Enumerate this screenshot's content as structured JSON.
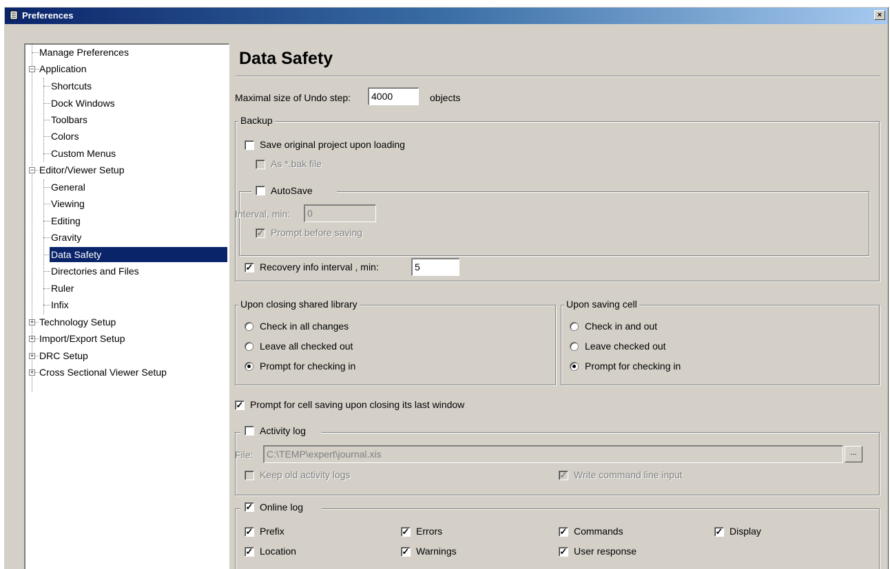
{
  "window": {
    "title": "Preferences",
    "close_glyph": "×"
  },
  "tree": {
    "items": [
      {
        "label": "Manage Preferences"
      },
      {
        "label": "Application",
        "expander": "−"
      },
      {
        "label": "Shortcuts"
      },
      {
        "label": "Dock Windows"
      },
      {
        "label": "Toolbars"
      },
      {
        "label": "Colors"
      },
      {
        "label": "Custom Menus"
      },
      {
        "label": "Editor/Viewer Setup",
        "expander": "−"
      },
      {
        "label": "General"
      },
      {
        "label": "Viewing"
      },
      {
        "label": "Editing"
      },
      {
        "label": "Gravity"
      },
      {
        "label": "Data Safety",
        "selected": true
      },
      {
        "label": "Directories and Files"
      },
      {
        "label": "Ruler"
      },
      {
        "label": "Infix"
      },
      {
        "label": "Technology Setup",
        "expander": "+"
      },
      {
        "label": "Import/Export Setup",
        "expander": "+"
      },
      {
        "label": "DRC Setup",
        "expander": "+"
      },
      {
        "label": "Cross Sectional Viewer Setup",
        "expander": "+"
      }
    ]
  },
  "page": {
    "title": "Data Safety",
    "undo": {
      "label": "Maximal size of Undo step:",
      "value": "4000",
      "unit": "objects"
    },
    "backup": {
      "caption": "Backup",
      "save_original": {
        "label": "Save original project upon loading",
        "checked": false
      },
      "bak_file": {
        "label": "As *.bak file",
        "checked": false
      },
      "autosave": {
        "label": "AutoSave",
        "checked": false,
        "interval_label": "Interval, min:",
        "interval_value": "0",
        "prompt_label": "Prompt before saving",
        "prompt_checked": true
      },
      "recovery": {
        "label": "Recovery info interval , min:",
        "value": "5",
        "checked": true
      }
    },
    "closing_library": {
      "caption": "Upon closing shared library",
      "options": [
        {
          "label": "Check in all changes",
          "selected": false
        },
        {
          "label": "Leave all checked out",
          "selected": false
        },
        {
          "label": "Prompt for checking in",
          "selected": true
        }
      ]
    },
    "saving_cell": {
      "caption": "Upon saving cell",
      "options": [
        {
          "label": "Check in and out",
          "selected": false
        },
        {
          "label": "Leave checked out",
          "selected": false
        },
        {
          "label": "Prompt for checking in",
          "selected": true
        }
      ]
    },
    "prompt_cell_saving": {
      "label": "Prompt for cell saving upon closing its last window",
      "checked": true
    },
    "activity_log": {
      "label": "Activity log",
      "checked": false,
      "file_label": "File:",
      "file_value": "C:\\TEMP\\expert\\journal.xis",
      "browse_label": "...",
      "keep_old": {
        "label": "Keep old activity logs",
        "checked": false
      },
      "write_cmd": {
        "label": "Write command line input",
        "checked": true
      }
    },
    "online_log": {
      "label": "Online log",
      "checked": true,
      "options": [
        {
          "label": "Prefix",
          "checked": true
        },
        {
          "label": "Errors",
          "checked": true
        },
        {
          "label": "Commands",
          "checked": true
        },
        {
          "label": "Display",
          "checked": true
        },
        {
          "label": "Location",
          "checked": true
        },
        {
          "label": "Warnings",
          "checked": true
        },
        {
          "label": "User response",
          "checked": true
        }
      ]
    },
    "check_glyph": "✓"
  }
}
